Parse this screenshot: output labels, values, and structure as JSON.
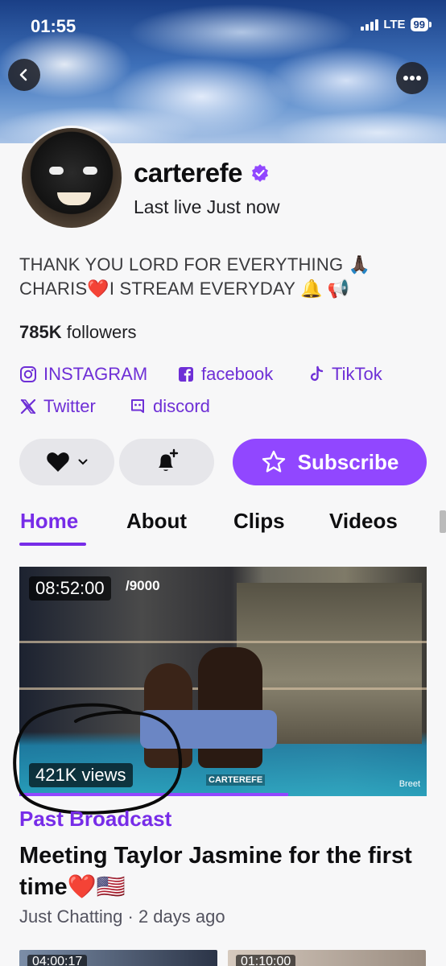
{
  "status_bar": {
    "time": "01:55",
    "network": "LTE",
    "battery": "99"
  },
  "profile": {
    "username": "carterefe",
    "last_live": "Last live Just now",
    "bio": "THANK YOU LORD FOR EVERYTHING 🙏🏿 CHARIS❤️I STREAM EVERYDAY 🔔 📢",
    "followers_count": "785K",
    "followers_label": "followers"
  },
  "links": {
    "instagram": "INSTAGRAM",
    "facebook": "facebook",
    "tiktok": "TikTok",
    "twitter": "Twitter",
    "discord": "discord"
  },
  "actions": {
    "subscribe_label": "Subscribe"
  },
  "tabs": [
    "Home",
    "About",
    "Clips",
    "Videos"
  ],
  "featured_video": {
    "duration": "08:52:00",
    "overlay": "/9000",
    "views": "421K views",
    "watermark": "CARTEREFE",
    "watermark2": "Breet",
    "label": "Past Broadcast",
    "title": "Meeting Taylor Jasmine for the first time❤️🇺🇸",
    "meta": "Just Chatting · 2 days ago",
    "watched_fraction": 0.66
  },
  "next_videos": [
    {
      "duration": "04:00:17"
    },
    {
      "duration": "01:10:00"
    }
  ],
  "colors": {
    "accent": "#9147ff",
    "accent_text": "#772ce8",
    "link": "#6e2fd6"
  }
}
